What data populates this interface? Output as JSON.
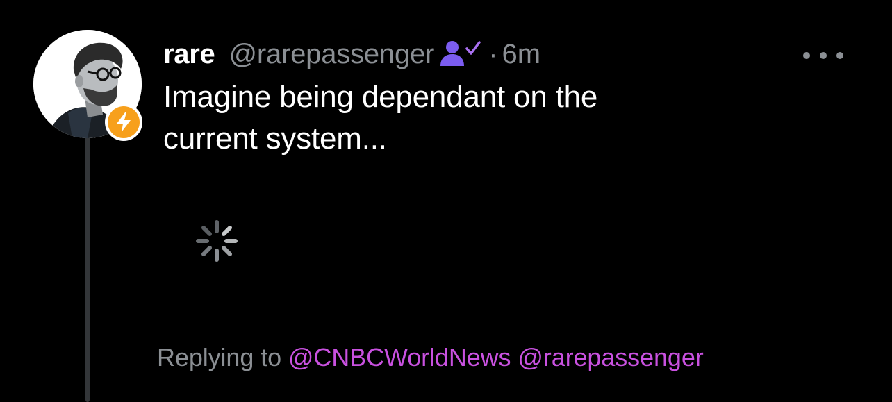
{
  "post": {
    "display_name": "rare",
    "handle": "@rarepassenger",
    "separator": "·",
    "time": "6m",
    "text": "Imagine being dependant on the\ncurrent system...",
    "replying_prefix": "Replying to",
    "mentions": [
      "@CNBCWorldNews",
      "@rarepassenger"
    ]
  },
  "icons": {
    "verified": "person-check-icon",
    "badge": "lightning-bolt-icon",
    "more": "more-horizontal-icon",
    "loading": "loading-spinner-icon"
  },
  "colors": {
    "background": "#000000",
    "text": "#ffffff",
    "muted": "#8b8f94",
    "mention": "#c951e0",
    "verified": "#7b5cf0",
    "badge": "#f7a01c",
    "thread_line": "#333639"
  }
}
